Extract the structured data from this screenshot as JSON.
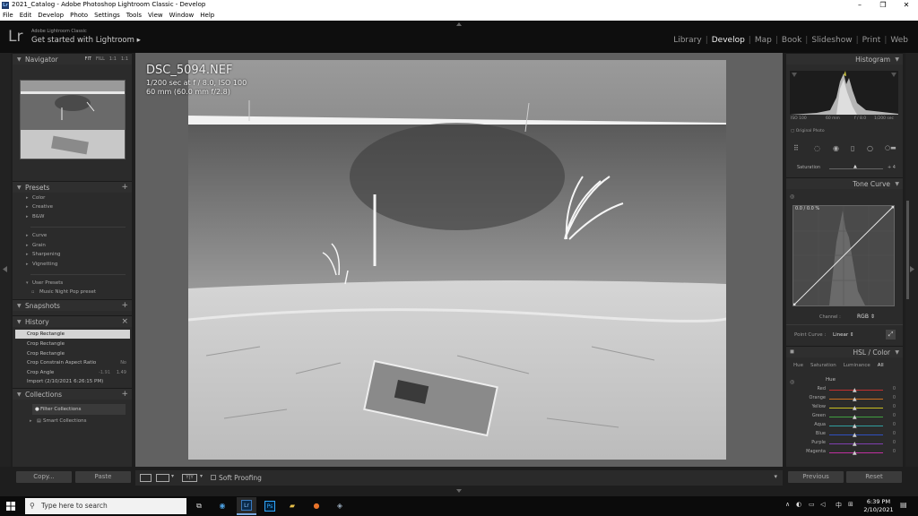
{
  "window": {
    "title": "2021_Catalog - Adobe Photoshop Lightroom Classic - Develop",
    "app_icon_text": "Lr",
    "minimize": "–",
    "maximize": "❐",
    "close": "✕"
  },
  "menu": [
    "File",
    "Edit",
    "Develop",
    "Photo",
    "Settings",
    "Tools",
    "View",
    "Window",
    "Help"
  ],
  "identity": {
    "logo": "Lr",
    "brand": "Adobe Lightroom Classic",
    "tagline": "Get started with Lightroom",
    "tagline_arrow": "▸"
  },
  "modules": [
    "Library",
    "Develop",
    "Map",
    "Book",
    "Slideshow",
    "Print",
    "Web"
  ],
  "active_module": "Develop",
  "left": {
    "navigator": {
      "title": "Navigator",
      "options": [
        "FIT",
        "FILL",
        "1:1",
        "1:1"
      ]
    },
    "presets": {
      "title": "Presets",
      "items": [
        "Color",
        "Creative",
        "B&W",
        "Curve",
        "Grain",
        "Sharpening",
        "Vignetting",
        "User Presets",
        "Music Night Pop preset"
      ]
    },
    "snapshots": {
      "title": "Snapshots"
    },
    "history": {
      "title": "History",
      "clear": "×",
      "items": [
        {
          "label": "Crop Rectangle",
          "v1": "",
          "v2": ""
        },
        {
          "label": "Crop Rectangle",
          "v1": "",
          "v2": ""
        },
        {
          "label": "Crop Rectangle",
          "v1": "",
          "v2": ""
        },
        {
          "label": "Crop Constrain Aspect Ratio",
          "v1": "",
          "v2": "No"
        },
        {
          "label": "Crop Angle",
          "v1": "-1.91",
          "v2": "1.49"
        },
        {
          "label": "Import (2/10/2021 6:26:15 PM)",
          "v1": "",
          "v2": ""
        }
      ]
    },
    "collections": {
      "title": "Collections",
      "filter": "Filter Collections",
      "smart": "Smart Collections"
    },
    "copy_button": "Copy...",
    "paste_button": "Paste"
  },
  "photo": {
    "filename": "DSC_5094.NEF",
    "exposure": "1/200 sec at f / 8.0, ISO 100",
    "lens": "60 mm (60.0 mm f/2.8)"
  },
  "toolbar": {
    "soft_proofing": "Soft Proofing",
    "yy": "Y|Y"
  },
  "right": {
    "histogram": {
      "title": "Histogram",
      "iso": "ISO 100",
      "focal": "60 mm",
      "aperture": "f / 8.0",
      "shutter": "1/200 sec",
      "original_photo": "Original Photo"
    },
    "saturation": {
      "label": "Saturation",
      "value": "+ 4"
    },
    "tone_curve": {
      "title": "Tone Curve",
      "readout": "0.0 / 0.0 %",
      "channel_label": "Channel :",
      "channel_value": "RGB ⇕",
      "point_curve_label": "Point Curve :",
      "point_curve_value": "Linear ⇕"
    },
    "hsl": {
      "title": "HSL / Color",
      "tabs": [
        "Hue",
        "Saturation",
        "Luminance",
        "All"
      ],
      "section": "Hue",
      "rows": [
        {
          "name": "Red",
          "value": "0",
          "color": "#c03030"
        },
        {
          "name": "Orange",
          "value": "0",
          "color": "#d07020"
        },
        {
          "name": "Yellow",
          "value": "0",
          "color": "#c8c020"
        },
        {
          "name": "Green",
          "value": "0",
          "color": "#40a040"
        },
        {
          "name": "Aqua",
          "value": "0",
          "color": "#30a0a0"
        },
        {
          "name": "Blue",
          "value": "0",
          "color": "#3050c0"
        },
        {
          "name": "Purple",
          "value": "0",
          "color": "#8040b0"
        },
        {
          "name": "Magenta",
          "value": "0",
          "color": "#c030a0"
        }
      ]
    },
    "previous_button": "Previous",
    "reset_button": "Reset"
  },
  "taskbar": {
    "search_placeholder": "Type here to search",
    "apps": [
      "Lr",
      "Ps"
    ],
    "lang": "中",
    "time": "6:39 PM",
    "date": "2/10/2021"
  },
  "colors": {
    "accent": "#1d4a7a",
    "panel": "#2b2b2b",
    "center_bg": "#616161"
  }
}
